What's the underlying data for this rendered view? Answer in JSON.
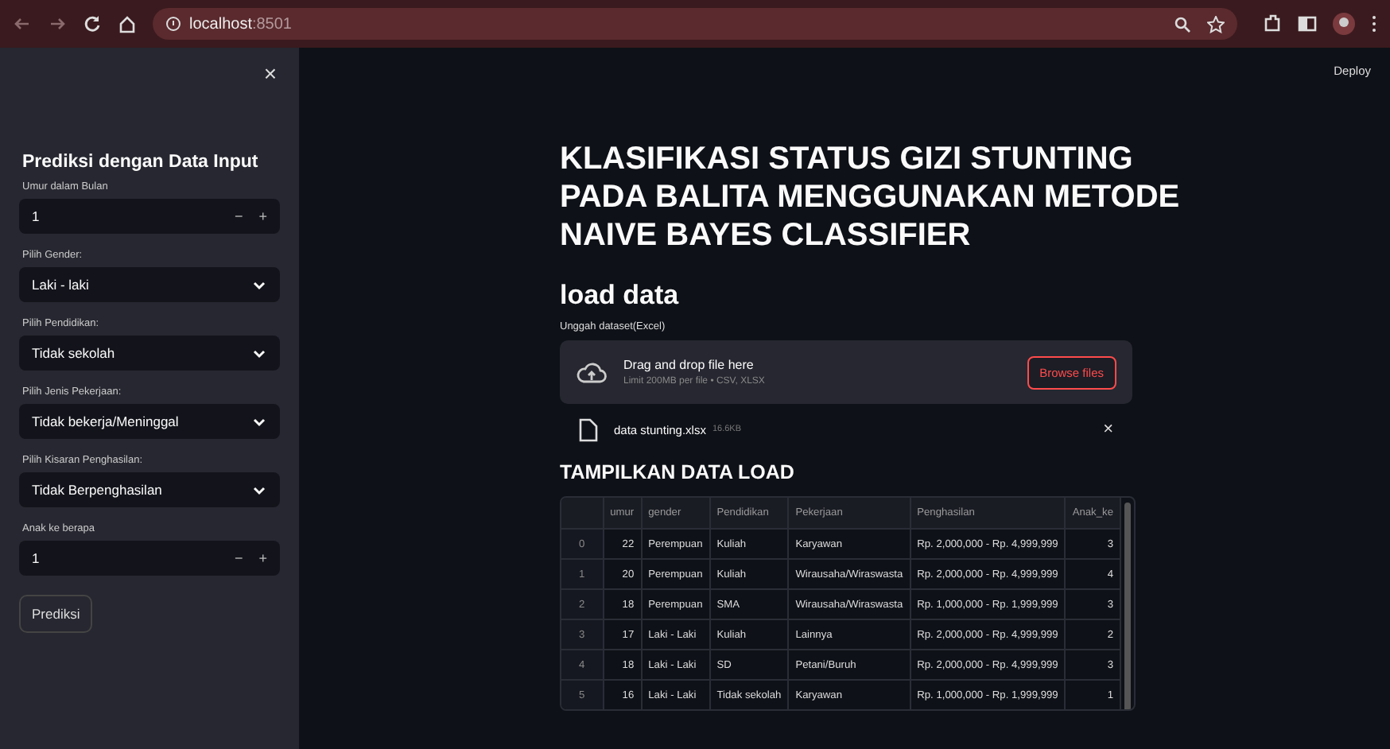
{
  "browser": {
    "host": "localhost",
    "port": ":8501"
  },
  "sidebar": {
    "close": "×",
    "title": "Prediksi dengan Data Input",
    "fields": [
      {
        "kind": "number",
        "label": "Umur dalam Bulan",
        "value": "1",
        "minus": "−",
        "plus": "+"
      },
      {
        "kind": "select",
        "label": "Pilih Gender:",
        "value": "Laki - laki"
      },
      {
        "kind": "select",
        "label": "Pilih Pendidikan:",
        "value": "Tidak sekolah"
      },
      {
        "kind": "select",
        "label": "Pilih Jenis Pekerjaan:",
        "value": "Tidak bekerja/Meninggal"
      },
      {
        "kind": "select",
        "label": "Pilih Kisaran Penghasilan:",
        "value": "Tidak Berpenghasilan"
      },
      {
        "kind": "number",
        "label": "Anak ke berapa",
        "value": "1",
        "minus": "−",
        "plus": "+"
      }
    ],
    "button": "Prediksi"
  },
  "main": {
    "deploy": "Deploy",
    "title": "KLASIFIKASI STATUS GIZI STUNTING PADA BALITA MENGGUNAKAN METODE NAIVE BAYES CLASSIFIER",
    "subtitle": "load data",
    "uploader": {
      "label": "Unggah dataset(Excel)",
      "drop_text": "Drag and drop file here",
      "limit": "Limit 200MB per file • CSV, XLSX",
      "button": "Browse files",
      "file_name": "data stunting.xlsx",
      "file_size": "16.6KB",
      "remove": "×"
    },
    "section": "TAMPILKAN DATA LOAD",
    "table": {
      "columns": [
        "umur",
        "gender",
        "Pendidikan",
        "Pekerjaan",
        "Penghasilan",
        "Anak_ke"
      ],
      "rows": [
        {
          "index": "0",
          "cells": [
            "22",
            "Perempuan",
            "Kuliah",
            "Karyawan",
            "Rp. 2,000,000 - Rp. 4,999,999",
            "3"
          ]
        },
        {
          "index": "1",
          "cells": [
            "20",
            "Perempuan",
            "Kuliah",
            "Wirausaha/Wiraswasta",
            "Rp. 2,000,000 - Rp. 4,999,999",
            "4"
          ]
        },
        {
          "index": "2",
          "cells": [
            "18",
            "Perempuan",
            "SMA",
            "Wirausaha/Wiraswasta",
            "Rp. 1,000,000 - Rp. 1,999,999",
            "3"
          ]
        },
        {
          "index": "3",
          "cells": [
            "17",
            "Laki - Laki",
            "Kuliah",
            "Lainnya",
            "Rp. 2,000,000 - Rp. 4,999,999",
            "2"
          ]
        },
        {
          "index": "4",
          "cells": [
            "18",
            "Laki - Laki",
            "SD",
            "Petani/Buruh",
            "Rp. 2,000,000 - Rp. 4,999,999",
            "3"
          ]
        },
        {
          "index": "5",
          "cells": [
            "16",
            "Laki - Laki",
            "Tidak sekolah",
            "Karyawan",
            "Rp. 1,000,000 - Rp. 1,999,999",
            "1"
          ]
        }
      ]
    }
  }
}
